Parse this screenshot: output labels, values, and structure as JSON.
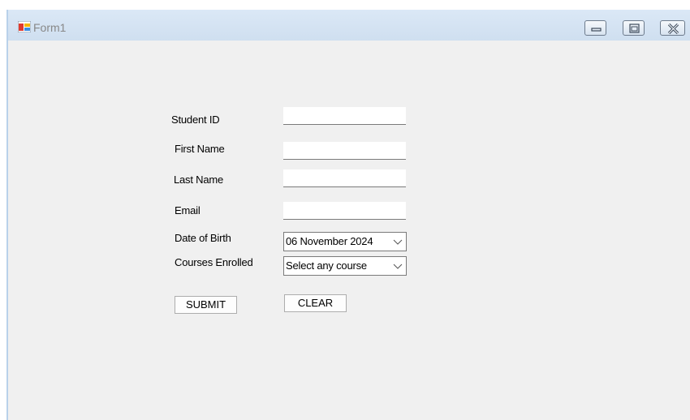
{
  "window": {
    "title": "Form1",
    "controls": {
      "minimize_icon": "minimize-icon",
      "maximize_icon": "maximize-icon",
      "close_icon": "close-icon"
    }
  },
  "form": {
    "student_id": {
      "label": "Student ID",
      "value": ""
    },
    "first_name": {
      "label": "First Name",
      "value": ""
    },
    "last_name": {
      "label": "Last Name",
      "value": ""
    },
    "email": {
      "label": "Email",
      "value": ""
    },
    "date_of_birth": {
      "label": "Date of Birth",
      "value": "06 November 2024"
    },
    "courses_enrolled": {
      "label": "Courses Enrolled",
      "value": "Select any course"
    },
    "submit_label": "SUBMIT",
    "clear_label": "CLEAR"
  },
  "colors": {
    "form_background": "#f0f0f0",
    "titlebar": "#dbe8f6",
    "title_text": "#888888"
  }
}
